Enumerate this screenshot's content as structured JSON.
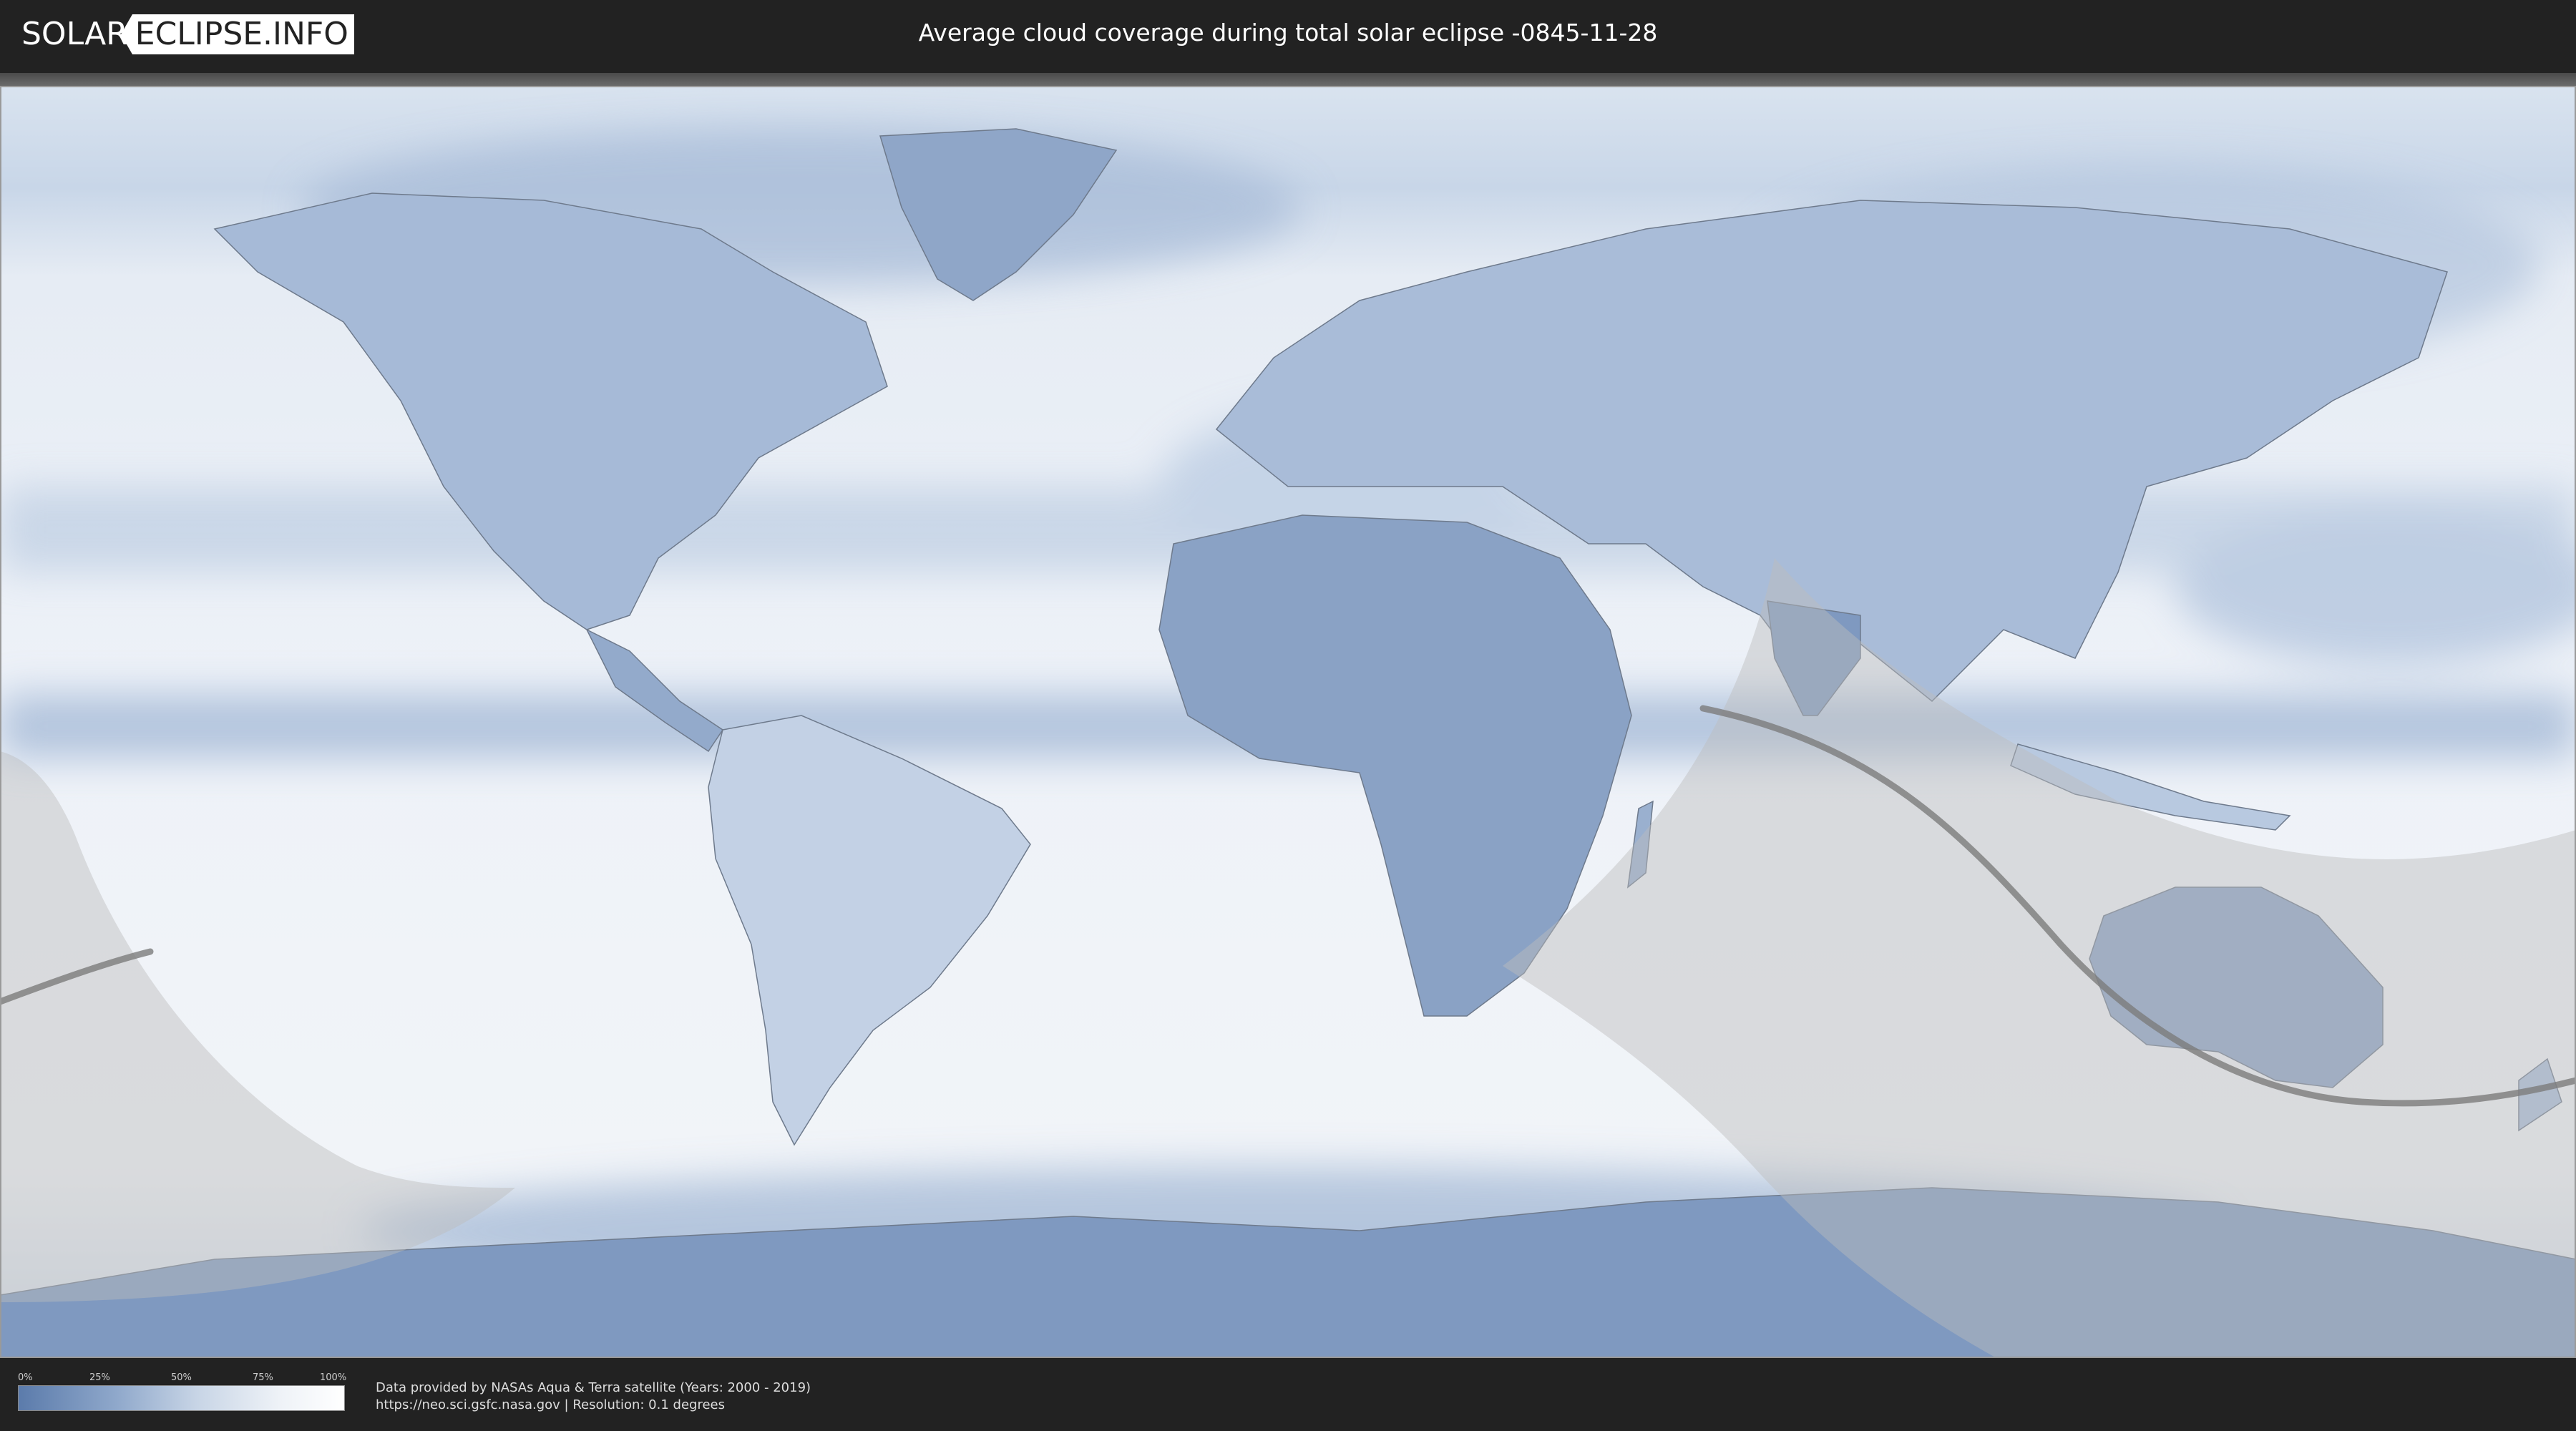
{
  "header": {
    "logo_part1": "SOLAR",
    "logo_part2": "ECLIPSE.INFO",
    "title": "Average cloud coverage during total solar eclipse -0845-11-28"
  },
  "legend": {
    "ticks": [
      "0%",
      "25%",
      "50%",
      "75%",
      "100%"
    ],
    "colors": {
      "low": "#5b7bab",
      "high": "#ffffff"
    }
  },
  "footer": {
    "credit_line1": "Data provided by NASAs Aqua & Terra satellite (Years: 2000 - 2019)",
    "credit_line2": "https://neo.sci.gsfc.nasa.gov | Resolution: 0.1 degrees"
  },
  "map": {
    "projection": "equirectangular",
    "colors": {
      "ocean_clear": "#edf1f7",
      "cloud_dense": "#6e8cb8",
      "penumbra_shade": "#cfcfcf",
      "eclipse_path": "#7c7c7c",
      "coast": "#6e7a8c"
    }
  }
}
